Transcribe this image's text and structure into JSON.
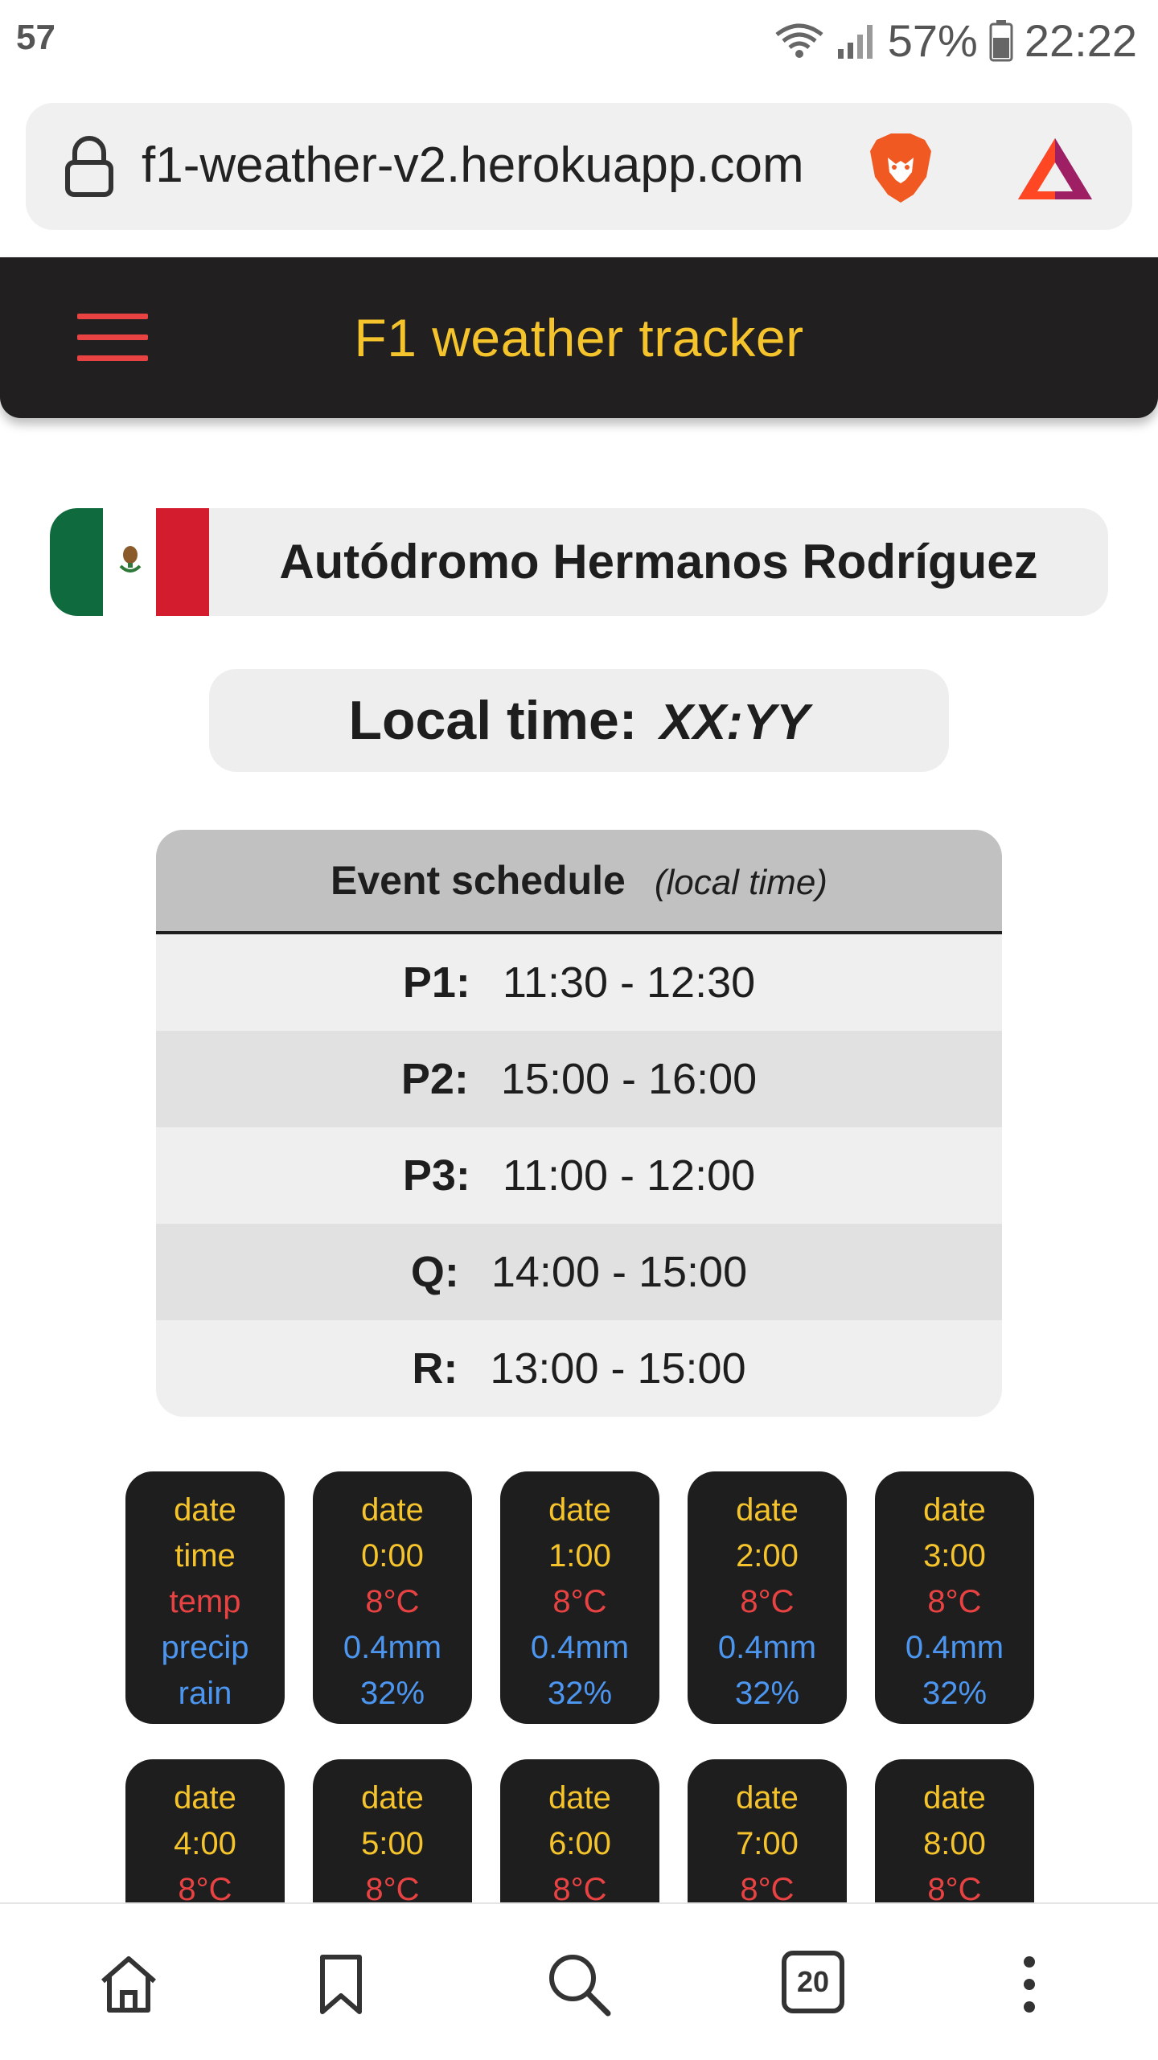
{
  "status_bar": {
    "left": "57",
    "battery": "57%",
    "clock": "22:22"
  },
  "browser": {
    "url": "f1-weather-v2.herokuapp.com",
    "tab_count": "20"
  },
  "app": {
    "title": "F1 weather tracker"
  },
  "circuit": {
    "name": "Autódromo Hermanos Rodríguez",
    "flag_colors": [
      "#0f6a3d",
      "#ffffff",
      "#d41c2f"
    ]
  },
  "local_time": {
    "label": "Local time:",
    "value": "XX:YY"
  },
  "schedule": {
    "title": "Event schedule",
    "note": "(local time)",
    "rows": [
      {
        "label": "P1:",
        "time": "11:30 - 12:30"
      },
      {
        "label": "P2:",
        "time": "15:00 - 16:00"
      },
      {
        "label": "P3:",
        "time": "11:00 - 12:00"
      },
      {
        "label": "Q:",
        "time": "14:00 - 15:00"
      },
      {
        "label": "R:",
        "time": "13:00 - 15:00"
      }
    ]
  },
  "forecast_row1": [
    {
      "date": "date",
      "time": "time",
      "temp": "temp",
      "precip": "precip",
      "rain": "rain"
    },
    {
      "date": "date",
      "time": "0:00",
      "temp": "8°C",
      "precip": "0.4mm",
      "rain": "32%"
    },
    {
      "date": "date",
      "time": "1:00",
      "temp": "8°C",
      "precip": "0.4mm",
      "rain": "32%"
    },
    {
      "date": "date",
      "time": "2:00",
      "temp": "8°C",
      "precip": "0.4mm",
      "rain": "32%"
    },
    {
      "date": "date",
      "time": "3:00",
      "temp": "8°C",
      "precip": "0.4mm",
      "rain": "32%"
    }
  ],
  "forecast_row2": [
    {
      "date": "date",
      "time": "4:00",
      "temp": "8°C"
    },
    {
      "date": "date",
      "time": "5:00",
      "temp": "8°C"
    },
    {
      "date": "date",
      "time": "6:00",
      "temp": "8°C"
    },
    {
      "date": "date",
      "time": "7:00",
      "temp": "8°C"
    },
    {
      "date": "date",
      "time": "8:00",
      "temp": "8°C"
    }
  ],
  "colors": {
    "header_bg": "#211f20",
    "accent_yellow": "#f5c42c",
    "temp_red": "#e84242",
    "precip_blue": "#4c96f0",
    "card_bg": "#1f1e1f"
  }
}
